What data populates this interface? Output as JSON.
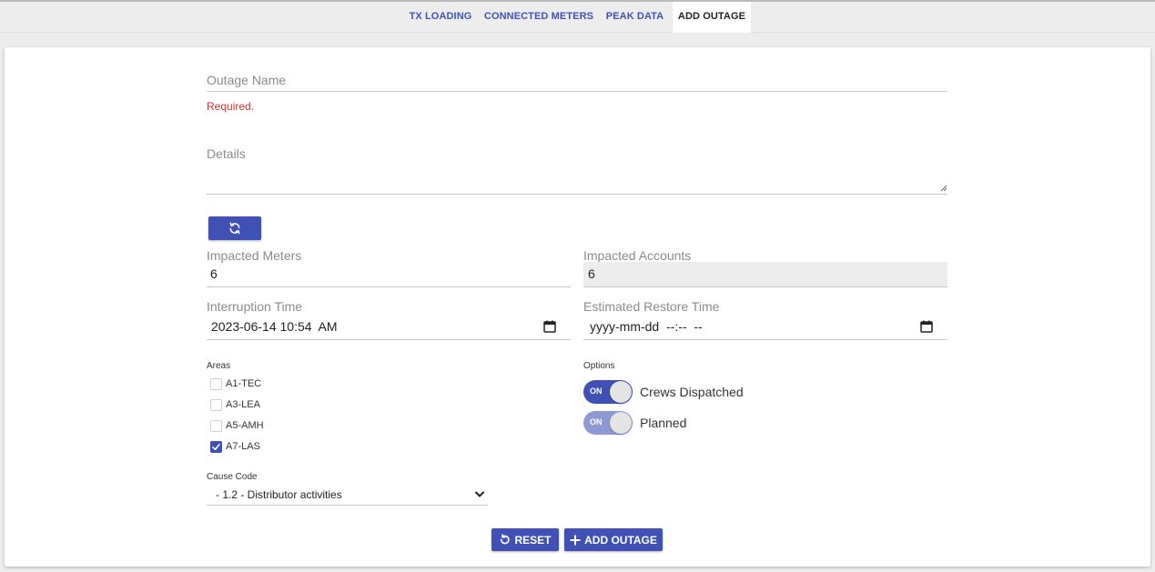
{
  "tabs": [
    {
      "label": "TX LOADING"
    },
    {
      "label": "CONNECTED METERS"
    },
    {
      "label": "PEAK DATA"
    },
    {
      "label": "ADD OUTAGE"
    }
  ],
  "active_tab": "ADD OUTAGE",
  "form": {
    "outage_name": {
      "label": "Outage Name",
      "value": "",
      "error": "Required."
    },
    "details": {
      "label": "Details",
      "value": ""
    },
    "refresh_icon": "refresh-icon",
    "impacted_meters": {
      "label": "Impacted Meters",
      "value": "6"
    },
    "impacted_accounts": {
      "label": "Impacted Accounts",
      "value": "6"
    },
    "interruption_time": {
      "label": "Interruption Time",
      "value": "2023-06-14 10:54  AM"
    },
    "estimated_restore_time": {
      "label": "Estimated Restore Time",
      "value": "yyyy-mm-dd  --:--  --"
    },
    "areas": {
      "label": "Areas",
      "items": [
        {
          "label": "A1-TEC",
          "checked": false
        },
        {
          "label": "A3-LEA",
          "checked": false
        },
        {
          "label": "A5-AMH",
          "checked": false
        },
        {
          "label": "A7-LAS",
          "checked": true
        }
      ]
    },
    "options": {
      "label": "Options",
      "items": [
        {
          "label": "Crews Dispatched",
          "state": "ON",
          "enabled": true
        },
        {
          "label": "Planned",
          "state": "ON",
          "enabled": false
        }
      ]
    },
    "cause_code": {
      "label": "Cause Code",
      "value": "- 1.2 - Distributor activities"
    }
  },
  "actions": {
    "reset_label": "RESET",
    "add_label": "ADD OUTAGE"
  },
  "colors": {
    "primary": "#3f51b5",
    "error": "#d32f2f",
    "disabled_field": "#ededed"
  }
}
